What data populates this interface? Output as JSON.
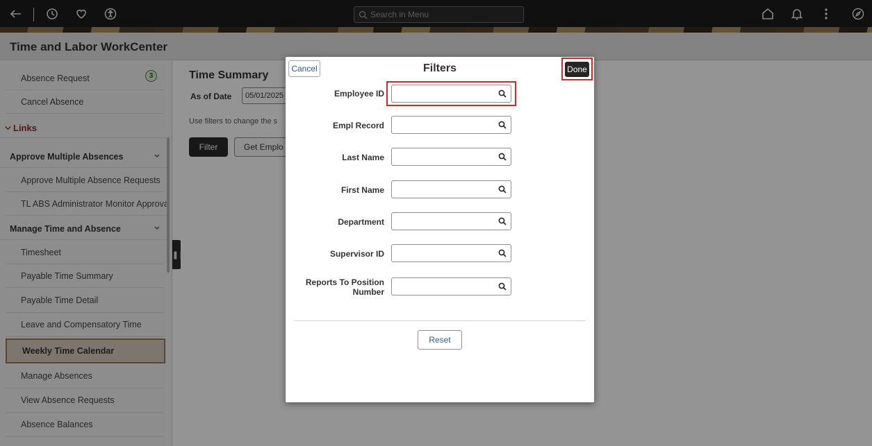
{
  "topbar": {
    "search_placeholder": "Search in Menu",
    "icons": [
      "back-arrow-icon",
      "history-icon",
      "favorites-heart-icon",
      "accessibility-icon",
      "home-icon",
      "notification-bell-icon",
      "more-options-icon",
      "navigator-compass-icon"
    ]
  },
  "header": {
    "title": "Time and Labor WorkCenter"
  },
  "sidebar": {
    "top_items": [
      {
        "label": "Absence Request",
        "badge": "3"
      },
      {
        "label": "Cancel Absence"
      }
    ],
    "links_label": "Links",
    "groups": [
      {
        "label": "Approve Multiple Absences",
        "items": [
          "Approve Multiple Absence Requests",
          "TL ABS Administrator Monitor Approva"
        ]
      },
      {
        "label": "Manage Time and Absence",
        "items": [
          "Timesheet",
          "Payable Time Summary",
          "Payable Time Detail",
          "Leave and Compensatory Time",
          "Weekly Time Calendar",
          "Manage Absences",
          "View Absence Requests",
          "Absence Balances"
        ]
      }
    ],
    "selected_item": "Weekly Time Calendar"
  },
  "main": {
    "title": "Time Summary",
    "as_of_label": "As of Date",
    "as_of_value": "05/01/2025",
    "filters_help": "Use filters to change the s",
    "filter_button": "Filter",
    "get_employees_button": "Get Emplo"
  },
  "modal": {
    "title": "Filters",
    "cancel_label": "Cancel",
    "done_label": "Done",
    "fields": [
      {
        "label": "Employee ID",
        "value": ""
      },
      {
        "label": "Empl Record",
        "value": ""
      },
      {
        "label": "Last Name",
        "value": ""
      },
      {
        "label": "First Name",
        "value": ""
      },
      {
        "label": "Department",
        "value": ""
      },
      {
        "label": "Supervisor ID",
        "value": ""
      },
      {
        "label": "Reports To Position",
        "label2": "Number",
        "value": ""
      }
    ],
    "reset_label": "Reset"
  },
  "colors": {
    "highlight": "#cc2b2b",
    "link_blue": "#2f5a9a",
    "links_heading": "#8a2b2b",
    "selected_bg": "#d8cbbf",
    "badge_green": "#4b8a3a"
  }
}
